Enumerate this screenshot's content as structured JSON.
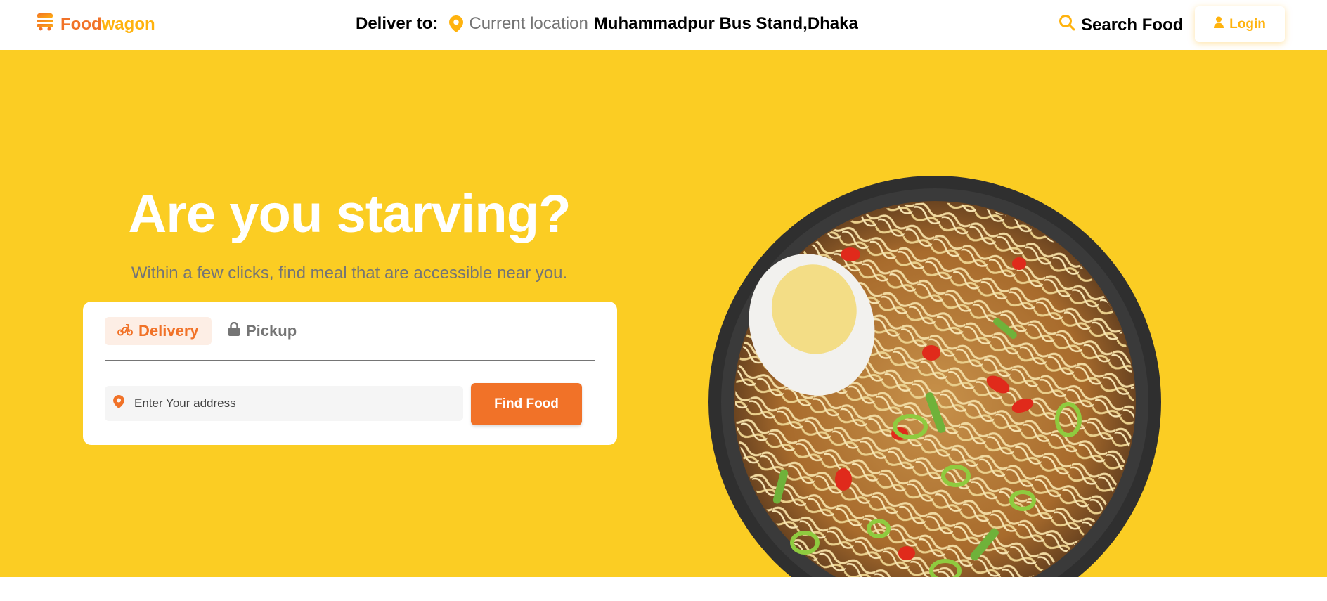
{
  "nav": {
    "brand_part1": "Food",
    "brand_part2": "wagon",
    "deliver_label": "Deliver to:",
    "current_location_label": "Current location",
    "location": "Muhammadpur Bus Stand,Dhaka",
    "search_label": "Search Food",
    "login_label": "Login"
  },
  "hero": {
    "title": "Are you starving?",
    "subtitle": "Within a few clicks, find meal that are accessible near you.",
    "tabs": [
      {
        "label": "Delivery",
        "icon": "motorbike-icon",
        "active": true
      },
      {
        "label": "Pickup",
        "icon": "lock-icon",
        "active": false
      }
    ],
    "address_placeholder": "Enter Your address",
    "find_button": "Find Food"
  },
  "colors": {
    "accent_orange": "#f17228",
    "accent_yellow": "#ffb30e",
    "hero_bg": "#fbcd23",
    "muted_text": "#757575"
  }
}
